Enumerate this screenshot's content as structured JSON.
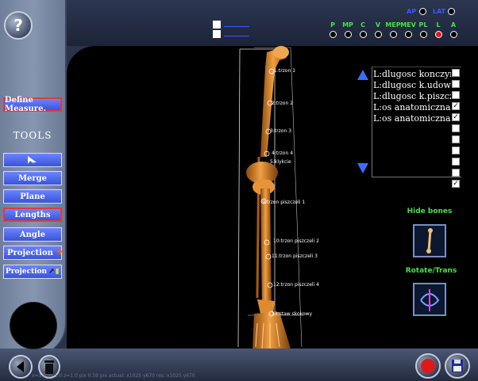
{
  "help": {
    "label": "?"
  },
  "toolbar": {
    "define_measure": "Define Measure.",
    "tools_title": "TOOLS",
    "merge": "Merge",
    "plane": "Plane",
    "lengths": "Lengths",
    "angle": "Angle",
    "projection1": "Projection",
    "projection2": "Projection"
  },
  "top_links": {
    "link1": "________",
    "link2": "________"
  },
  "views": {
    "ap_label": "AP",
    "lat_label": "LAT",
    "modes": [
      "P",
      "MP",
      "C",
      "V",
      "MEP",
      "MEV",
      "PL",
      "L",
      "A"
    ],
    "selected": "L"
  },
  "list": {
    "items": [
      {
        "label": "L:dlugosc konczyny",
        "checked": false
      },
      {
        "label": "L:dlugosc k.udowej",
        "checked": false
      },
      {
        "label": "L:dlugosc k.piszczelowej",
        "checked": false
      },
      {
        "label": "L:os anatomiczna uda",
        "checked": true
      },
      {
        "label": "L:os anatomiczna p",
        "checked": true
      }
    ],
    "empty_checks": [
      false,
      false,
      false,
      false,
      false,
      false,
      true
    ]
  },
  "hide_bones": {
    "label": "Hide bones"
  },
  "rotate_trans": {
    "label": "Rotate/Trans"
  },
  "bone_labels": [
    "1:trzon 1",
    "2:trzon 2",
    "3:trzon 3",
    "4:trzon 4",
    "5:klykcie",
    "9:trzon piszczeli 1",
    "10:trzon piszczeli 2",
    "11:trzon piszczeli 3",
    "12:trzon piszczeli 4",
    "13:staw skokowy"
  ],
  "status": {
    "text": "x=1.0 y=1.0 z=1.0 pix 0.59 pix actual: x1025 y670 res: x1025 y670"
  },
  "colors": {
    "accent": "#3b54d8",
    "highlight": "#e23a3a",
    "bone": "#d8862a",
    "active_radio": "#e01818"
  }
}
